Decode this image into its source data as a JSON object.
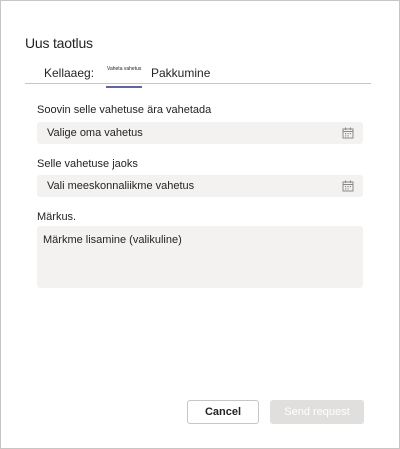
{
  "dialog": {
    "title": "Uus taotlus"
  },
  "tabs": {
    "items": [
      {
        "label": "Kellaaeg:"
      },
      {
        "label": "Vahetа vahetus",
        "selected": true
      },
      {
        "label": "Pakkumine"
      }
    ]
  },
  "form": {
    "own_shift": {
      "label": "Soovin selle vahetuse ära vahetada",
      "value": "Valige oma vahetus",
      "icon": "calendar-icon"
    },
    "teammate_shift": {
      "label": "Selle vahetuse jaoks",
      "value": "Vali meeskonnaliikme vahetus",
      "icon": "calendar-icon"
    },
    "note": {
      "label": "Märkus.",
      "placeholder": "Märkme lisamine (valikuline)"
    }
  },
  "actions": {
    "cancel_label": "Cancel",
    "send_label": "Send request"
  },
  "colors": {
    "accent": "#6264a7",
    "field_bg": "#f3f2f1",
    "disabled_button_bg": "#e1dfdd"
  }
}
